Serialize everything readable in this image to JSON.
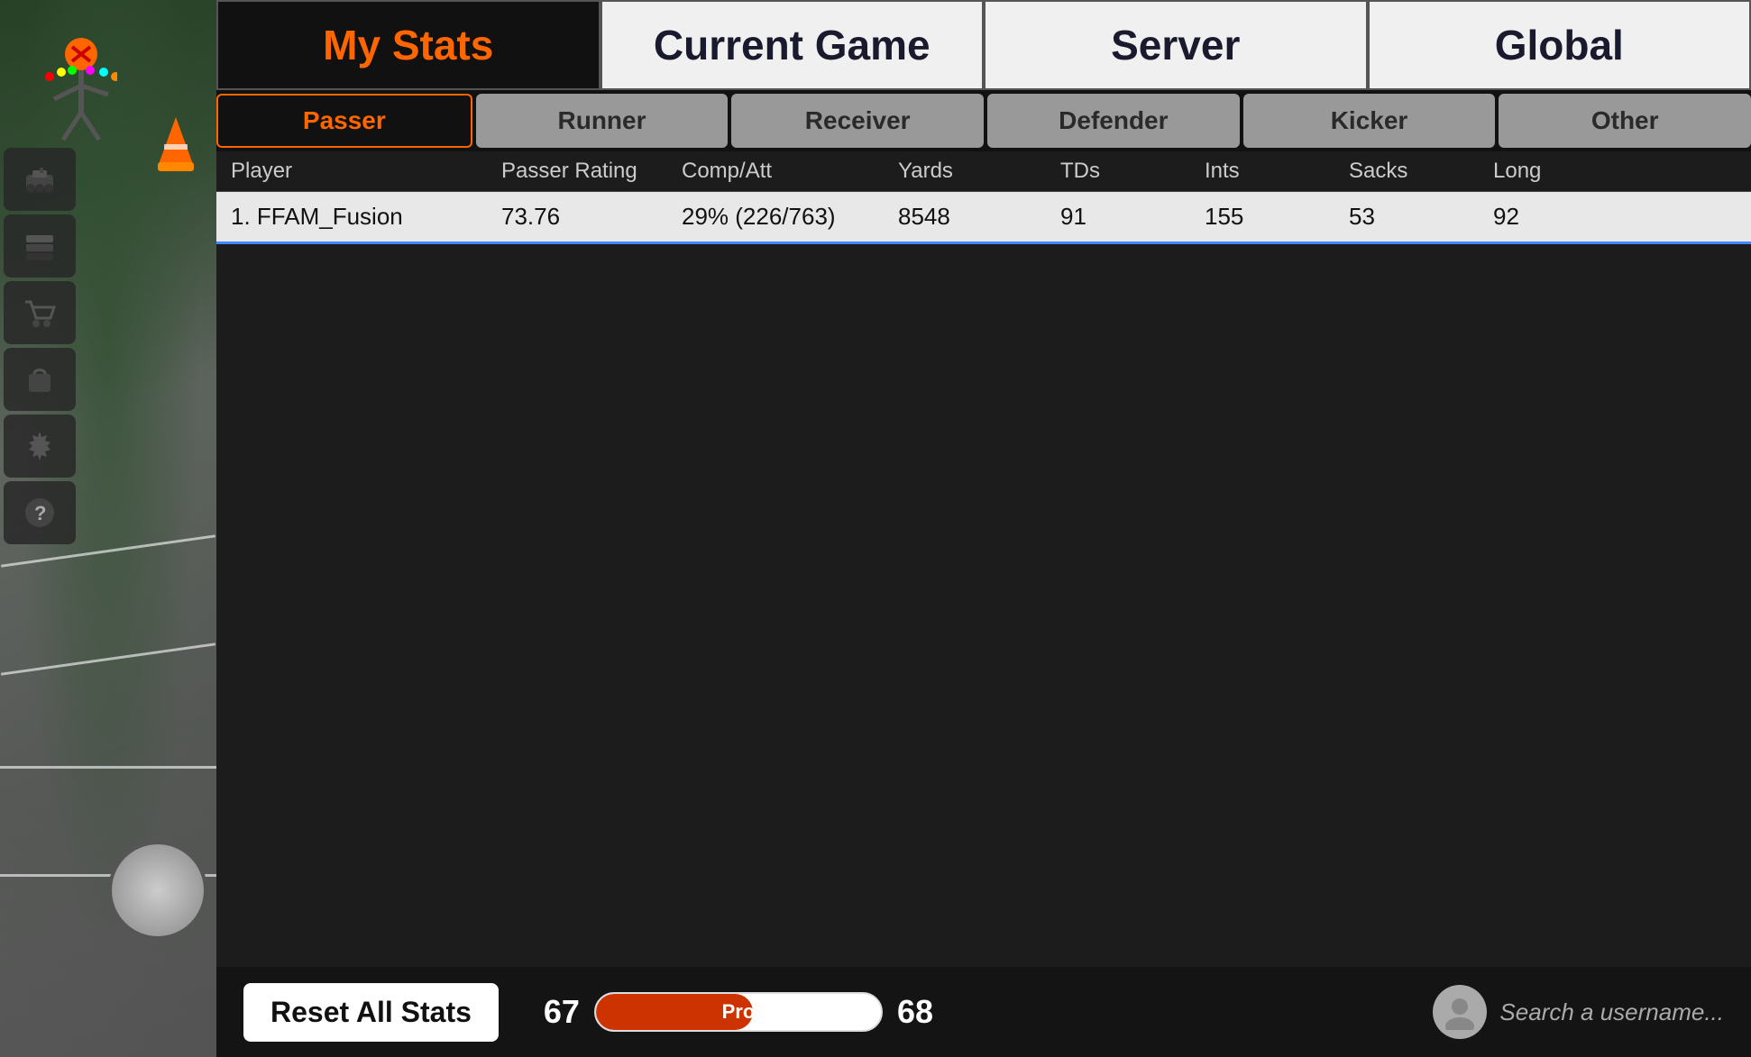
{
  "tabs": {
    "top": [
      {
        "id": "my-stats",
        "label": "My Stats",
        "active": true
      },
      {
        "id": "current-game",
        "label": "Current Game",
        "active": false
      },
      {
        "id": "server",
        "label": "Server",
        "active": false
      },
      {
        "id": "global",
        "label": "Global",
        "active": false
      }
    ],
    "position": [
      {
        "id": "passer",
        "label": "Passer",
        "active": true
      },
      {
        "id": "runner",
        "label": "Runner",
        "active": false
      },
      {
        "id": "receiver",
        "label": "Receiver",
        "active": false
      },
      {
        "id": "defender",
        "label": "Defender",
        "active": false
      },
      {
        "id": "kicker",
        "label": "Kicker",
        "active": false
      },
      {
        "id": "other",
        "label": "Other",
        "active": false
      }
    ]
  },
  "table": {
    "headers": [
      "Player",
      "Passer Rating",
      "Comp/Att",
      "Yards",
      "TDs",
      "Ints",
      "Sacks",
      "Long"
    ],
    "rows": [
      {
        "rank": "1.",
        "player": "FFAM_Fusion",
        "passer_rating": "73.76",
        "comp_att": "29% (226/763)",
        "yards": "8548",
        "tds": "91",
        "ints": "155",
        "sacks": "53",
        "long": "92"
      }
    ]
  },
  "bottom": {
    "reset_label": "Reset All Stats",
    "level_left": "67",
    "level_right": "68",
    "xp_label": "Pro",
    "xp_percent": 55,
    "search_placeholder": "Search a username..."
  },
  "sidebar": {
    "icons": [
      {
        "id": "tank-icon",
        "symbol": "🚗"
      },
      {
        "id": "stack-icon",
        "symbol": "📦"
      },
      {
        "id": "cart-icon",
        "symbol": "🛒"
      },
      {
        "id": "bag-icon",
        "symbol": "👜"
      },
      {
        "id": "gear-icon",
        "symbol": "⚙"
      },
      {
        "id": "help-icon",
        "symbol": "❓"
      }
    ]
  }
}
